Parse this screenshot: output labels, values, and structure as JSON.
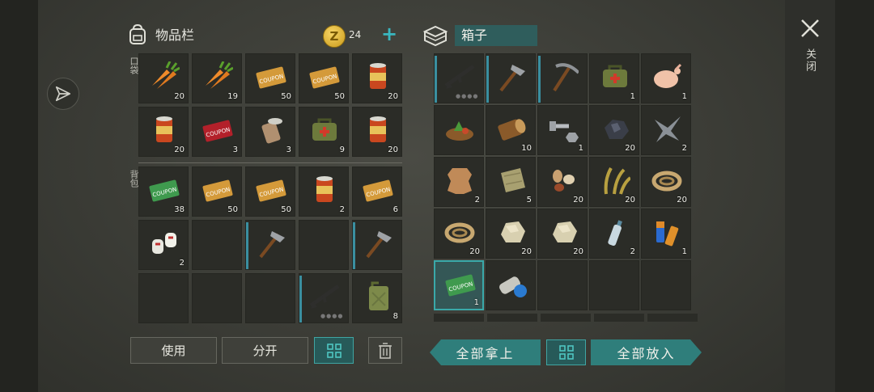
{
  "inventory": {
    "title": "物品栏",
    "coins": "24",
    "pocket_label": "口袋",
    "backpack_label": "背包"
  },
  "box": {
    "title": "箱子"
  },
  "pockets": [
    {
      "name": "carrot",
      "count": "20"
    },
    {
      "name": "carrot",
      "count": "19"
    },
    {
      "name": "survival-coupon",
      "count": "50"
    },
    {
      "name": "survival-coupon",
      "count": "50"
    },
    {
      "name": "canned-food",
      "count": "20"
    },
    {
      "name": "canned-food",
      "count": "20"
    },
    {
      "name": "survival-coupon-red",
      "count": "3"
    },
    {
      "name": "open-can",
      "count": "3"
    },
    {
      "name": "medical-bag",
      "count": "9"
    },
    {
      "name": "canned-food",
      "count": "20"
    }
  ],
  "backpack": [
    {
      "name": "ration-coupon",
      "count": "38"
    },
    {
      "name": "survival-coupon",
      "count": "50"
    },
    {
      "name": "survival-coupon",
      "count": "50"
    },
    {
      "name": "canned-food",
      "count": "2"
    },
    {
      "name": "survival-coupon",
      "count": "6"
    },
    {
      "name": "bandage",
      "count": "2"
    },
    {
      "name": "empty",
      "count": ""
    },
    {
      "name": "hatchet",
      "count": ""
    },
    {
      "name": "empty",
      "count": ""
    },
    {
      "name": "hatchet",
      "count": ""
    },
    {
      "name": "empty",
      "count": ""
    },
    {
      "name": "empty",
      "count": ""
    },
    {
      "name": "empty",
      "count": ""
    },
    {
      "name": "rifle",
      "count": ""
    },
    {
      "name": "jerrycan",
      "count": "8"
    }
  ],
  "box_items": [
    {
      "name": "rifle",
      "count": ""
    },
    {
      "name": "hatchet",
      "count": ""
    },
    {
      "name": "pickaxe",
      "count": ""
    },
    {
      "name": "medical-bag",
      "count": "1"
    },
    {
      "name": "raw-chicken",
      "count": "1"
    },
    {
      "name": "plant-pile",
      "count": ""
    },
    {
      "name": "log",
      "count": "10"
    },
    {
      "name": "bolt-nut",
      "count": "1"
    },
    {
      "name": "coal",
      "count": "20"
    },
    {
      "name": "scrap-metal",
      "count": "2"
    },
    {
      "name": "animal-hide",
      "count": "2"
    },
    {
      "name": "cloth",
      "count": "5"
    },
    {
      "name": "seeds",
      "count": "20"
    },
    {
      "name": "plant-fiber",
      "count": "20"
    },
    {
      "name": "rope",
      "count": "20"
    },
    {
      "name": "rope",
      "count": "20"
    },
    {
      "name": "stone",
      "count": "20"
    },
    {
      "name": "stone",
      "count": "20"
    },
    {
      "name": "plastic-bottle",
      "count": "2"
    },
    {
      "name": "battery",
      "count": "1"
    },
    {
      "name": "ration-coupon",
      "count": "1"
    },
    {
      "name": "tin-cans",
      "count": ""
    },
    {
      "name": "empty",
      "count": ""
    },
    {
      "name": "empty",
      "count": ""
    },
    {
      "name": "empty",
      "count": ""
    }
  ],
  "buttons": {
    "use": "使用",
    "split": "分开",
    "take_all": "全部拿上",
    "put_all": "全部放入",
    "close": "关闭"
  },
  "colors": {
    "accent": "#3aa9a9",
    "coin": "#e6b83a"
  }
}
